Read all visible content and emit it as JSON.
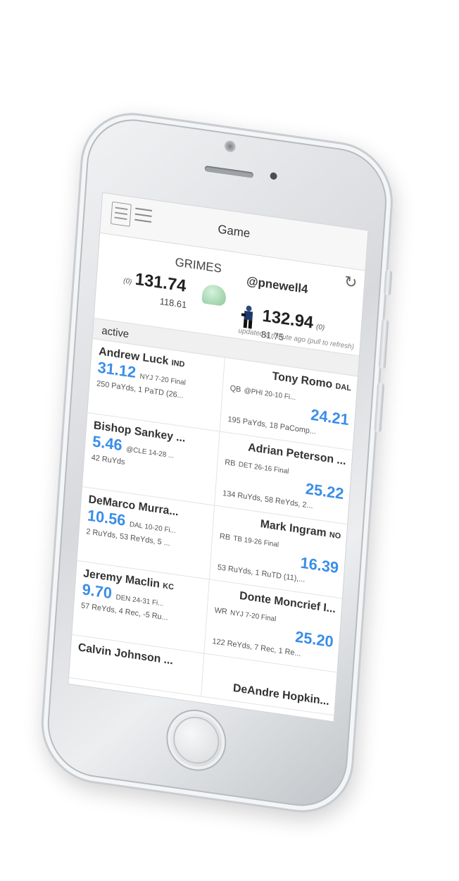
{
  "nav": {
    "title": "Game",
    "list_icon": "list-icon",
    "menu_icon": "menu-icon",
    "refresh_icon": "refresh-icon"
  },
  "teams": {
    "home": {
      "name": "GRIMES",
      "seed": "(0)",
      "score": "131.74",
      "projected": "118.61",
      "icon": "helmet-icon"
    },
    "away": {
      "name": "@pnewell4",
      "seed": "(0)",
      "score": "132.94",
      "projected": "81.75",
      "icon": "player-icon"
    }
  },
  "updated_text": "updated a minute ago (pull to refresh)",
  "section_label": "active",
  "matchups": [
    {
      "left": {
        "name": "Andrew Luck",
        "team": "IND",
        "points": "31.12",
        "game": "NYJ 7-20 Final",
        "stats": "250 PaYds, 1 PaTD (26..."
      },
      "pos": "QB",
      "right": {
        "name": "Tony Romo",
        "team": "DAL",
        "points": "24.21",
        "game": "@PHI 20-10 Fi...",
        "stats": "195 PaYds, 18 PaComp..."
      }
    },
    {
      "left": {
        "name": "Bishop Sankey ...",
        "team": "",
        "points": "5.46",
        "game": "@CLE 14-28 ...",
        "stats": "42 RuYds"
      },
      "pos": "RB",
      "right": {
        "name": "Adrian Peterson ...",
        "team": "",
        "points": "25.22",
        "game": "DET 26-16 Final",
        "stats": "134 RuYds, 58 ReYds, 2..."
      }
    },
    {
      "left": {
        "name": "DeMarco Murra...",
        "team": "",
        "points": "10.56",
        "game": "DAL 10-20 Fi...",
        "stats": "2 RuYds, 53 ReYds, 5 ..."
      },
      "pos": "RB",
      "right": {
        "name": "Mark Ingram",
        "team": "NO",
        "points": "16.39",
        "game": "TB 19-26 Final",
        "stats": "53 RuYds, 1 RuTD (11),..."
      }
    },
    {
      "left": {
        "name": "Jeremy Maclin",
        "team": "KC",
        "points": "9.70",
        "game": "DEN 24-31 Fi...",
        "stats": "57 ReYds, 4 Rec, -5 Ru..."
      },
      "pos": "WR",
      "right": {
        "name": "Donte Moncrief I...",
        "team": "",
        "points": "25.20",
        "game": "NYJ 7-20 Final",
        "stats": "122 ReYds, 7 Rec, 1 Re..."
      }
    },
    {
      "left": {
        "name": "Calvin Johnson ...",
        "team": "",
        "points": "",
        "game": "",
        "stats": ""
      },
      "pos": "",
      "right": {
        "name": "DeAndre Hopkin...",
        "team": "",
        "points": "",
        "game": "",
        "stats": ""
      }
    }
  ]
}
